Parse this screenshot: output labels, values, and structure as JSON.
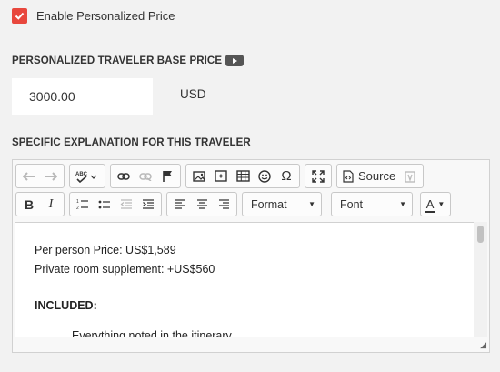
{
  "personalized": {
    "checkbox_label": "Enable Personalized Price",
    "checked": true
  },
  "base_price": {
    "title": "PERSONALIZED TRAVELER BASE PRICE",
    "value": "3000.00",
    "currency": "USD"
  },
  "explanation": {
    "title": "SPECIFIC EXPLANATION FOR THIS TRAVELER",
    "toolbar": {
      "source_label": "Source",
      "format_label": "Format",
      "font_label": "Font",
      "text_color_label": "A"
    },
    "content": {
      "line1": "Per person Price: US$1,589",
      "line2": "Private room supplement: +US$560",
      "heading": "INCLUDED:",
      "partial": "Everything noted in the itinerary"
    }
  },
  "colors": {
    "checkbox_accent": "#e8473d",
    "page_bg": "#f2f2f2"
  }
}
